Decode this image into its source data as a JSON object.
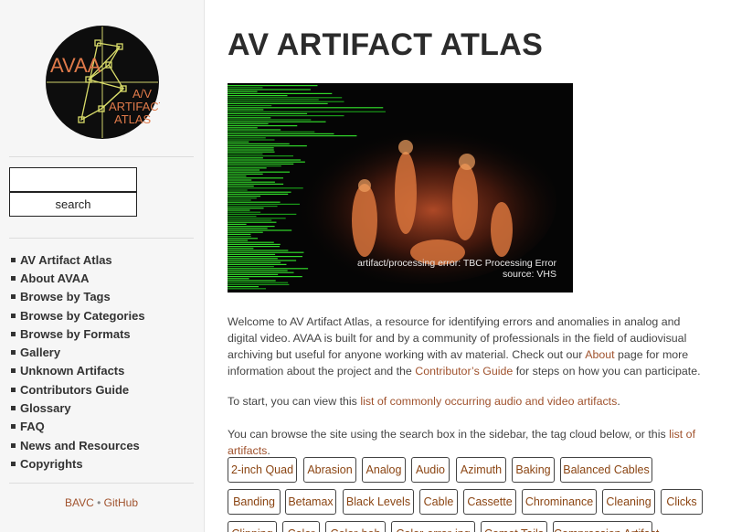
{
  "sidebar": {
    "logo": {
      "text_main": "AVAA",
      "text_sub1": "A/V",
      "text_sub2": "ARTIFACT",
      "text_sub3": "ATLAS"
    },
    "search": {
      "placeholder": "",
      "button_label": "search"
    },
    "nav": [
      "AV Artifact Atlas",
      "About AVAA",
      "Browse by Tags",
      "Browse by Categories",
      "Browse by Formats",
      "Gallery",
      "Unknown Artifacts",
      "Contributors Guide",
      "Glossary",
      "FAQ",
      "News and Resources",
      "Copyrights"
    ],
    "footer": {
      "link1": "BAVC",
      "separator": "•",
      "link2": "GitHub"
    }
  },
  "main": {
    "title": "AV ARTIFACT ATLAS",
    "hero": {
      "caption_line1": "artifact/processing error: TBC Processing Error",
      "caption_line2": "source: VHS"
    },
    "intro": {
      "t1": "Welcome to AV Artifact Atlas, a resource for identifying errors and anomalies in analog and digital video. AVAA is built for and by a community of professionals in the field of audiovisual archiving but useful for anyone working with av material. Check out our ",
      "link_about": "About",
      "t2": " page for more information about the project and the ",
      "link_guide": "Contributor’s Guide",
      "t3": " for steps on how you can participate."
    },
    "start": {
      "t1": "To start, you can view this ",
      "link": "list of commonly occurring audio and video artifacts",
      "t2": "."
    },
    "browse": {
      "t1": "You can browse the site using the search box in the sidebar, the tag cloud below, or this ",
      "link": "list of artifacts",
      "t2": "."
    },
    "tags_row1": [
      "2-inch Quad",
      "Abrasion",
      "Analog",
      "Audio",
      "Azimuth",
      "Baking",
      "Balanced Cables"
    ],
    "tags_row2": [
      "Banding",
      "Betamax",
      "Black Levels",
      "Cable",
      "Cassette",
      "Chrominance",
      "Cleaning",
      "Clicks"
    ],
    "tags_row3": [
      "Clipping",
      "Color",
      "Color-bob",
      "Color-error-ing",
      "Comet Tails",
      "Compression Artifact"
    ]
  }
}
